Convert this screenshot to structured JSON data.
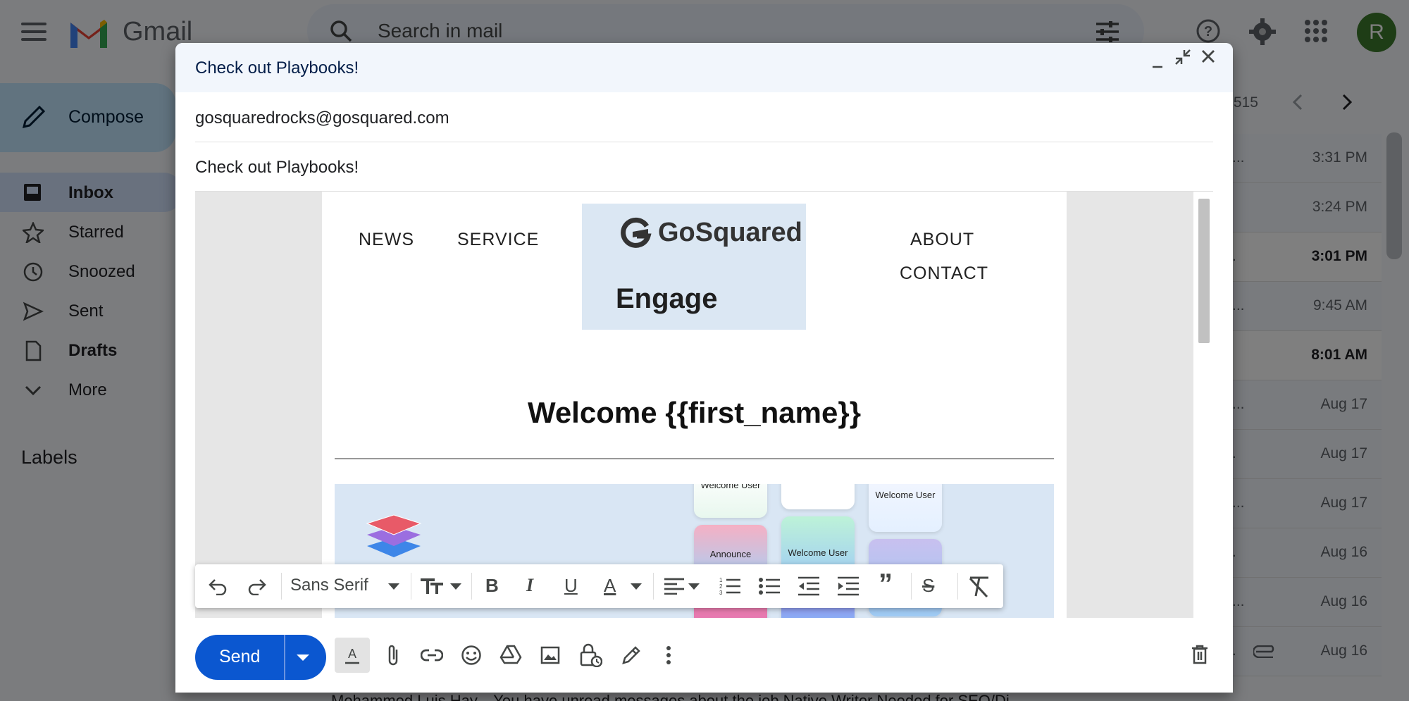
{
  "app": {
    "brand": "Gmail",
    "search_placeholder": "Search in mail",
    "avatar_letter": "R",
    "compose_label": "Compose",
    "nav": [
      {
        "label": "Inbox"
      },
      {
        "label": "Starred"
      },
      {
        "label": "Snoozed"
      },
      {
        "label": "Sent"
      },
      {
        "label": "Drafts"
      },
      {
        "label": "More"
      }
    ],
    "labels_heading": "Labels",
    "count_text": ",515",
    "rows": [
      {
        "snippet": "...",
        "time": "3:31 PM",
        "unread": false
      },
      {
        "snippet": "",
        "time": "3:24 PM",
        "unread": false
      },
      {
        "snippet": ".",
        "time": "3:01 PM",
        "unread": true
      },
      {
        "snippet": "...",
        "time": "9:45 AM",
        "unread": false
      },
      {
        "snippet": "",
        "time": "8:01 AM",
        "unread": true
      },
      {
        "snippet": "...",
        "time": "Aug 17",
        "unread": false
      },
      {
        "snippet": ".",
        "time": "Aug 17",
        "unread": false
      },
      {
        "snippet": "...",
        "time": "Aug 17",
        "unread": false
      },
      {
        "snippet": ".",
        "time": "Aug 16",
        "unread": false
      },
      {
        "snippet": "...",
        "time": "Aug 16",
        "unread": false
      },
      {
        "snippet": ".",
        "time": "Aug 16",
        "unread": false
      }
    ],
    "bottom_row_text": "Mohammed Luis Hay...     You have unread messages about the job Native Writer Needed for SEO/Di"
  },
  "compose": {
    "title": "Check out Playbooks!",
    "to": "gosquaredrocks@gosquared.com",
    "subject": "Check out Playbooks!",
    "email": {
      "nav_left": [
        "NEWS",
        "SERVICE"
      ],
      "nav_right": [
        "ABOUT",
        "CONTACT"
      ],
      "logo_name": "GoSquared",
      "logo_sub": "Engage",
      "welcome": "Welcome {{first_name}}",
      "cards": [
        "Welcome User",
        "Welcome User",
        "Announce",
        "Welcome User"
      ]
    },
    "toolbar": {
      "font": "Sans Serif"
    },
    "send_label": "Send"
  },
  "colors": {
    "accent": "#0b57d0",
    "compose_bg": "#c2e7ff",
    "hero_bg": "#d9e6f4"
  }
}
